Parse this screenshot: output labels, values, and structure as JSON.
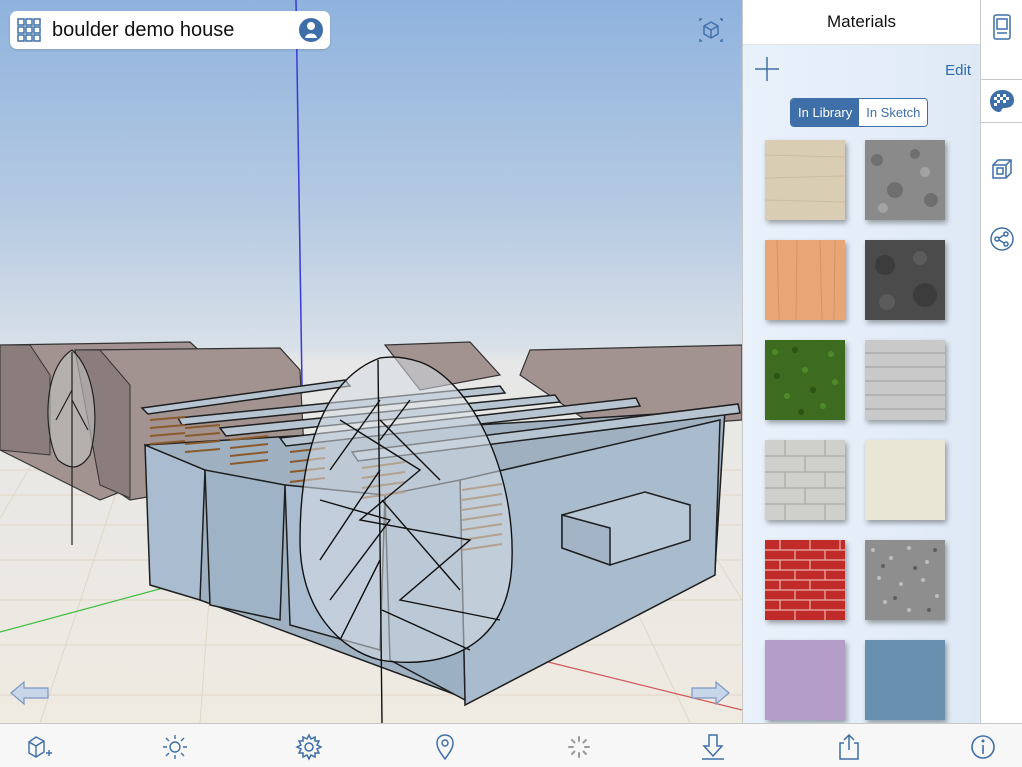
{
  "document": {
    "title": "boulder demo house"
  },
  "panel": {
    "title": "Materials",
    "edit_label": "Edit",
    "tabs": [
      {
        "label": "In Library",
        "selected": true
      },
      {
        "label": "In Sketch",
        "selected": false
      }
    ],
    "swatches": [
      {
        "name": "sand-render",
        "color": "#d9cdb3"
      },
      {
        "name": "gray-concrete",
        "color": "#8a8a8a"
      },
      {
        "name": "light-wood",
        "color": "#e8a676"
      },
      {
        "name": "dark-slate",
        "color": "#4a4b4a"
      },
      {
        "name": "grass",
        "color": "#3d6b1f"
      },
      {
        "name": "white-brick",
        "color": "#c9c9c9"
      },
      {
        "name": "gray-block",
        "color": "#cfd0cc"
      },
      {
        "name": "cream",
        "color": "#e9e6d6"
      },
      {
        "name": "red-brick",
        "color": "#c02a28"
      },
      {
        "name": "gravel",
        "color": "#8e8e8e"
      },
      {
        "name": "lavender",
        "color": "#b49ec7"
      },
      {
        "name": "steel-blue",
        "color": "#6690ae"
      }
    ]
  },
  "rail": {
    "icons": [
      "model-info-icon",
      "materials-icon",
      "components-icon",
      "share-icon"
    ],
    "active": "materials-icon"
  },
  "toolbar": {
    "icons": [
      "add-object-icon",
      "shadows-icon",
      "settings-icon",
      "location-icon",
      "loading-icon",
      "download-icon",
      "share-out-icon",
      "info-icon"
    ]
  },
  "colors": {
    "accent": "#3f6fa8",
    "link": "#2f69b2"
  }
}
